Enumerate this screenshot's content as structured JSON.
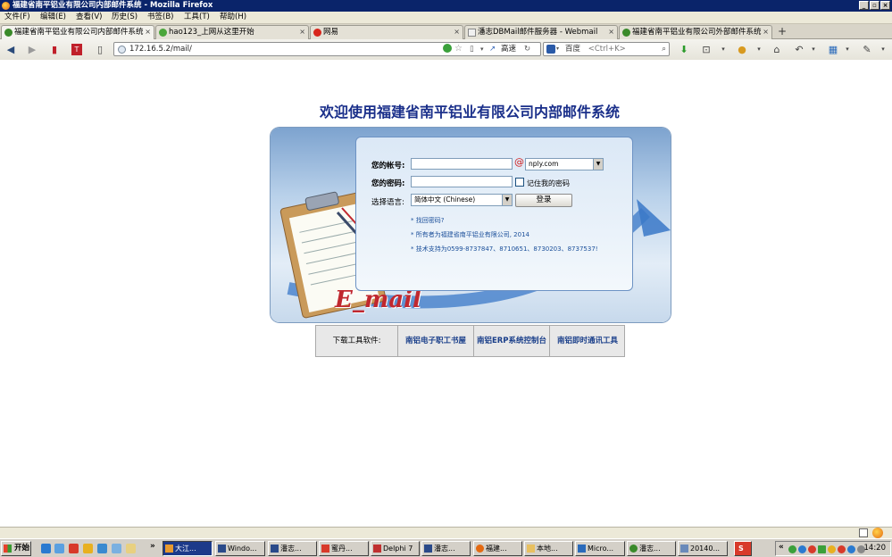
{
  "window": {
    "title": "福建省南平铝业有限公司内部邮件系统 - Mozilla Firefox"
  },
  "menu": [
    "文件(F)",
    "编辑(E)",
    "查看(V)",
    "历史(S)",
    "书签(B)",
    "工具(T)",
    "帮助(H)"
  ],
  "tabs": [
    {
      "label": "福建省南平铝业有限公司内部邮件系统",
      "active": true
    },
    {
      "label": "hao123_上网从这里开始",
      "active": false
    },
    {
      "label": "网易",
      "active": false
    },
    {
      "label": "潘志DBMail邮件服务器 - Webmail",
      "active": false
    },
    {
      "label": "福建省南平铝业有限公司外部邮件系统",
      "active": false
    }
  ],
  "nav": {
    "url": "172.16.5.2/mail/",
    "speed_label": "高速",
    "search_engine": "百度",
    "search_placeholder": "<Ctrl+K>"
  },
  "page": {
    "heading": "欢迎使用福建省南平铝业有限公司内部邮件系统",
    "login": {
      "account_label": "您的帐号:",
      "at_sign": "@",
      "domain": "nply.com",
      "password_label": "您的密码:",
      "remember_label": "记住我的密码",
      "language_label": "选择语言:",
      "language_value": "简体中文 (Chinese)",
      "submit_label": "登录"
    },
    "info": [
      "* 找回密码?",
      "* 所有者为福建省南平铝业有限公司, 2014",
      "* 技术支持为0599-8737847、8710651、8730203、8737537!"
    ],
    "email_logo": "E_mail",
    "tools": {
      "label": "下载工具软件:",
      "links": [
        "南铝电子职工书屋",
        "南铝ERP系统控制台",
        "南铝即时通讯工具"
      ]
    }
  },
  "taskbar": {
    "start_label": "开始",
    "items": [
      "大江...",
      "Windo...",
      "潘志...",
      "蜜丹...",
      "Delphi 7",
      "潘志...",
      "福建...",
      "本地...",
      "Micro...",
      "潘志...",
      "20140...",
      "S"
    ],
    "clock": "14:20"
  },
  "colors": {
    "title_bar": "#0a246a",
    "heading": "#1a2f8a",
    "panel_blue": "#7da3cf",
    "link_blue": "#1a3f8a",
    "email_logo": "#c0282f"
  }
}
